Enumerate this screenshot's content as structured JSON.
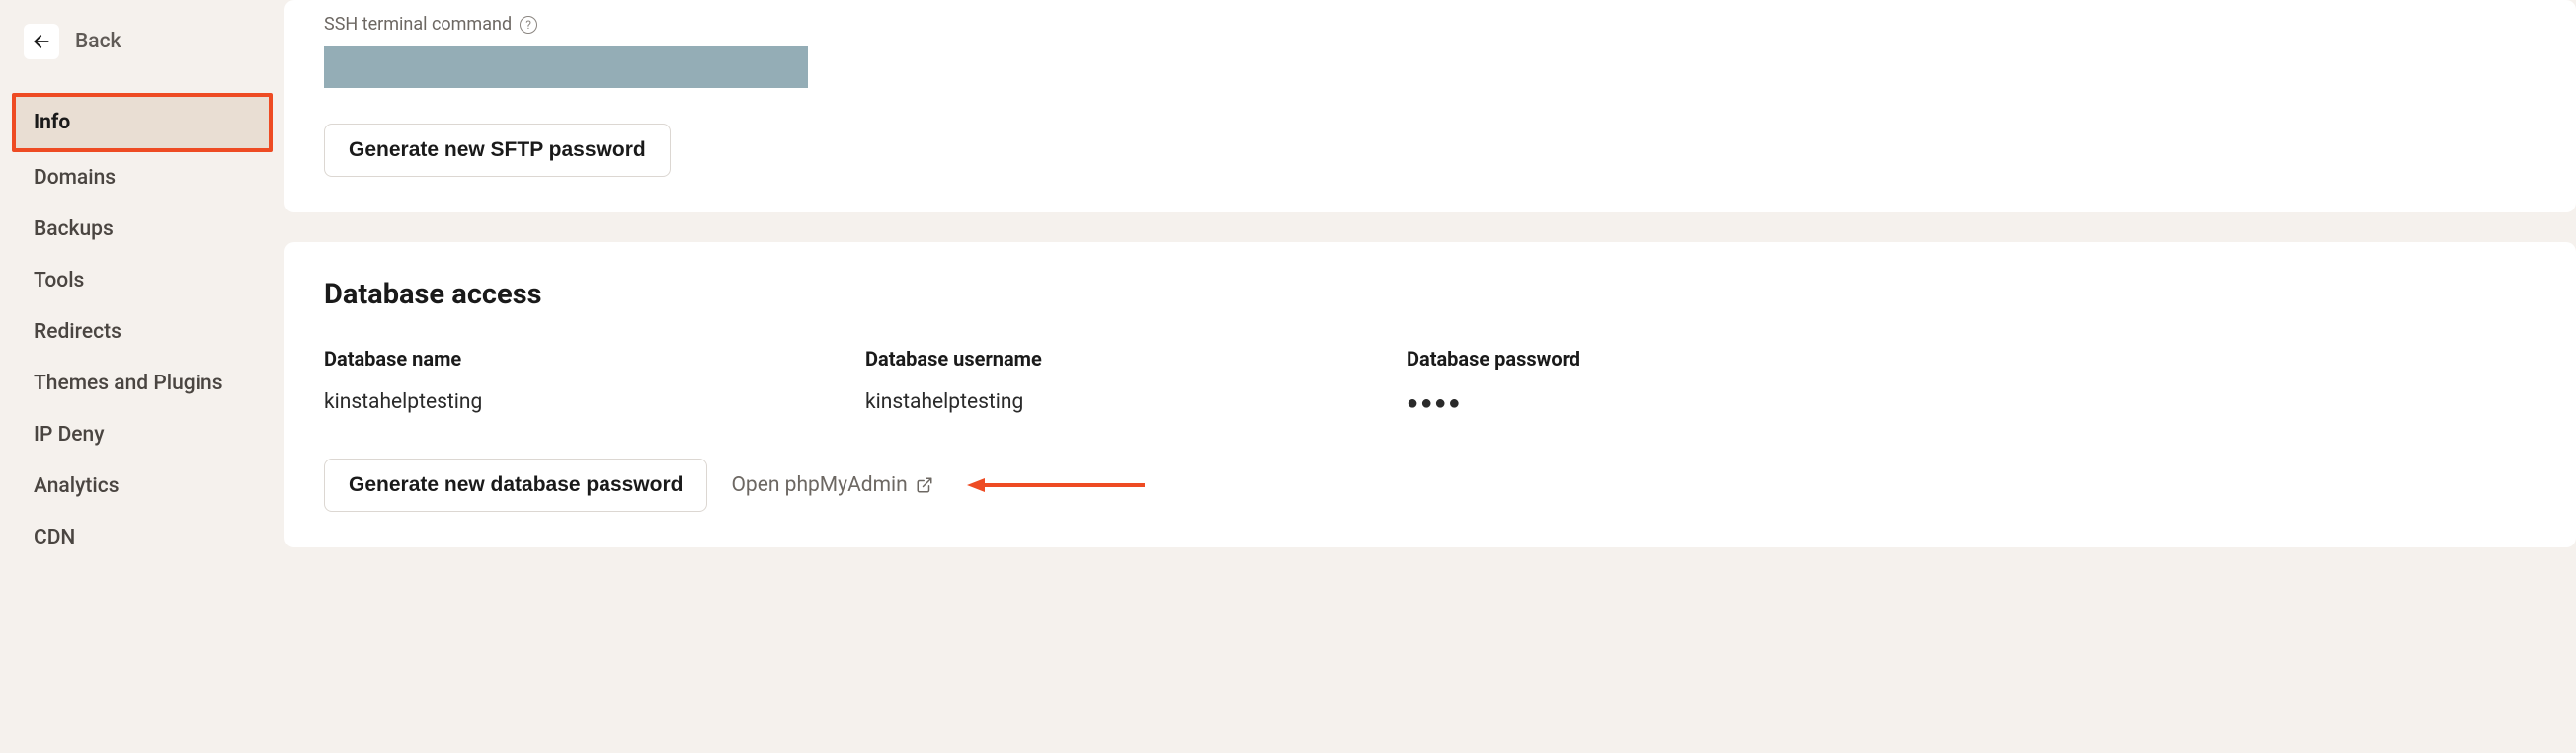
{
  "back": {
    "label": "Back"
  },
  "sidebar": {
    "items": [
      {
        "label": "Info",
        "active": true
      },
      {
        "label": "Domains",
        "active": false
      },
      {
        "label": "Backups",
        "active": false
      },
      {
        "label": "Tools",
        "active": false
      },
      {
        "label": "Redirects",
        "active": false
      },
      {
        "label": "Themes and Plugins",
        "active": false
      },
      {
        "label": "IP Deny",
        "active": false
      },
      {
        "label": "Analytics",
        "active": false
      },
      {
        "label": "CDN",
        "active": false
      }
    ]
  },
  "ssh": {
    "label": "SSH terminal command",
    "generate_button": "Generate new SFTP password"
  },
  "database": {
    "section_title": "Database access",
    "name_label": "Database name",
    "name_value": "kinstahelptesting",
    "username_label": "Database username",
    "username_value": "kinstahelptesting",
    "password_label": "Database password",
    "password_value": "●●●●",
    "generate_button": "Generate new database password",
    "open_link": "Open phpMyAdmin"
  }
}
